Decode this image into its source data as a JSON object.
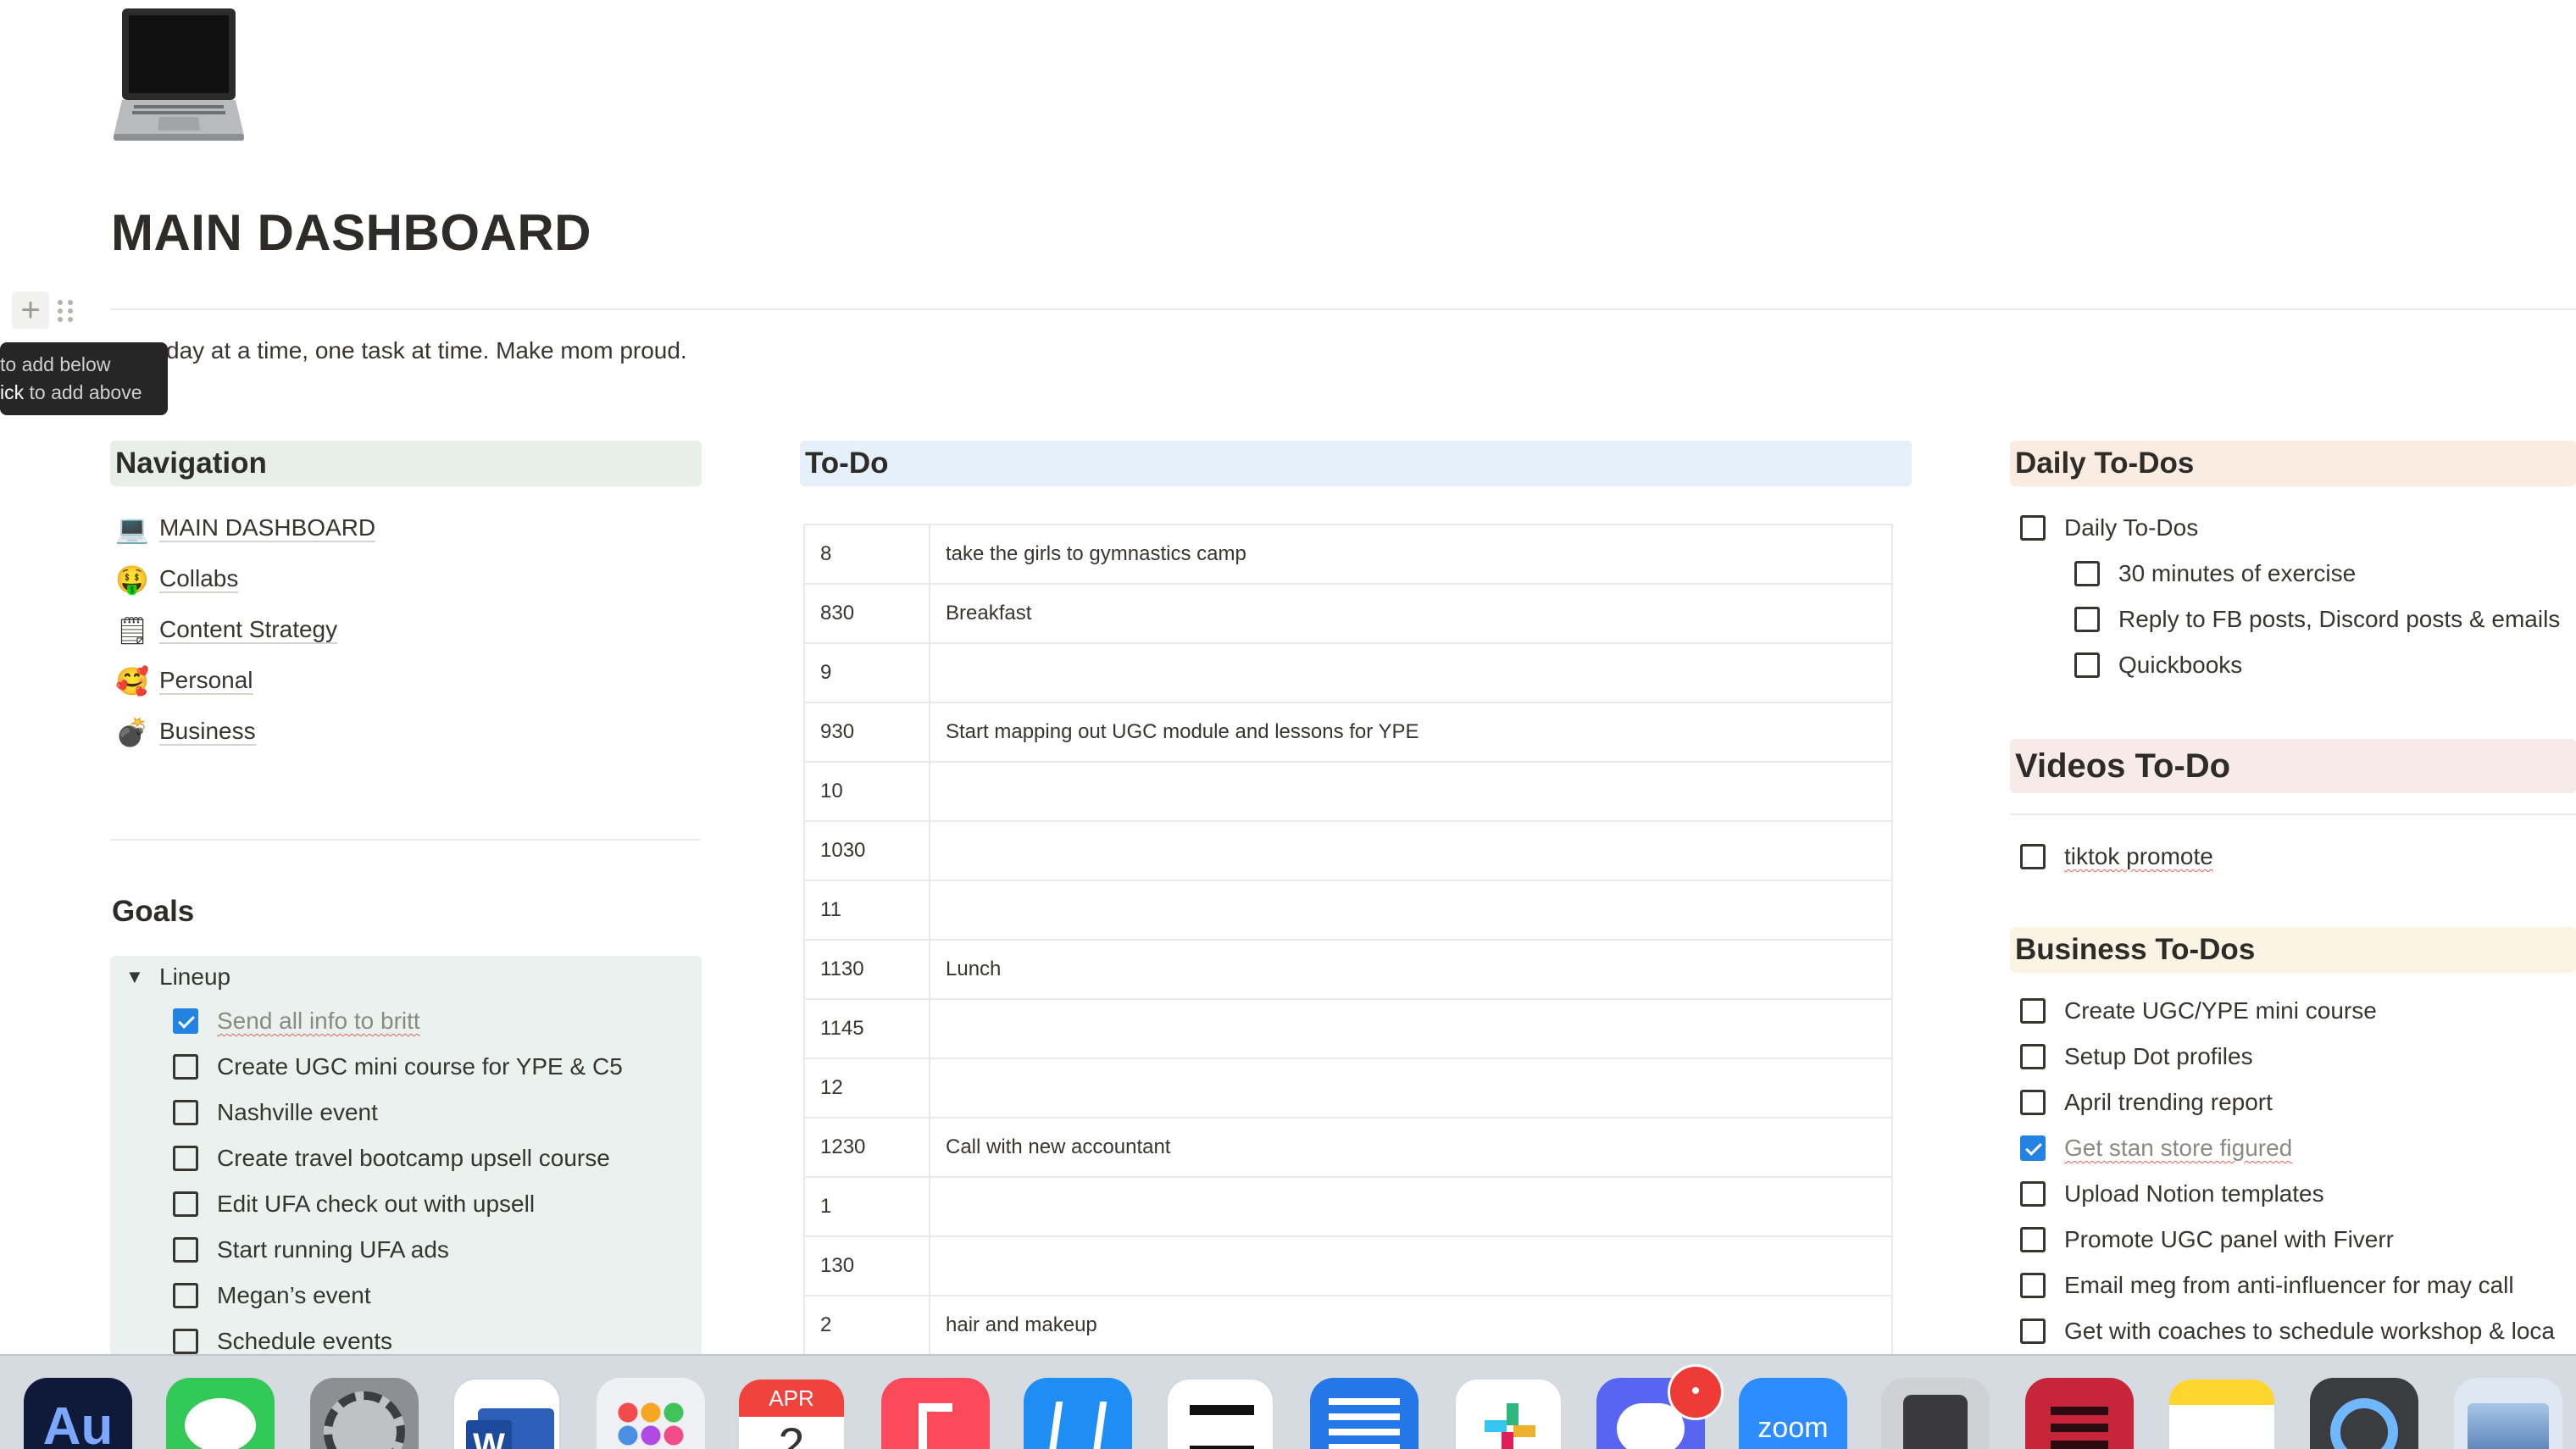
{
  "page": {
    "icon": "laptop-icon",
    "title": "MAIN DASHBOARD",
    "subtitle": "day at a time, one task at time. Make mom proud."
  },
  "block_tooltip": {
    "line1": "to add below",
    "line2_key": "ick",
    "line2_rest": " to add above"
  },
  "navigation": {
    "heading": "Navigation",
    "items": [
      {
        "emoji": "💻",
        "label": "MAIN DASHBOARD"
      },
      {
        "emoji": "🤑",
        "label": "Collabs"
      },
      {
        "emoji": "🗒",
        "label": "Content Strategy"
      },
      {
        "emoji": "🥰",
        "label": "Personal"
      },
      {
        "emoji": "💣",
        "label": "Business"
      }
    ]
  },
  "goals": {
    "heading": "Goals",
    "toggle_label": "Lineup",
    "items": [
      {
        "label": "Send all info to britt",
        "checked": true
      },
      {
        "label": "Create UGC mini course for YPE & C5",
        "checked": false
      },
      {
        "label": "Nashville event",
        "checked": false
      },
      {
        "label": "Create travel bootcamp upsell course",
        "checked": false
      },
      {
        "label": "Edit UFA check out with upsell",
        "checked": false
      },
      {
        "label": "Start running UFA ads",
        "checked": false
      },
      {
        "label": "Megan’s event",
        "checked": false
      },
      {
        "label": "Schedule events",
        "checked": false
      }
    ]
  },
  "todo": {
    "heading": "To-Do",
    "rows": [
      {
        "time": "8",
        "task": "take the girls to gymnastics camp"
      },
      {
        "time": "830",
        "task": "Breakfast"
      },
      {
        "time": "9",
        "task": ""
      },
      {
        "time": "930",
        "task": "Start mapping out UGC module and lessons for YPE"
      },
      {
        "time": "10",
        "task": ""
      },
      {
        "time": "1030",
        "task": ""
      },
      {
        "time": "11",
        "task": ""
      },
      {
        "time": "1130",
        "task": "Lunch"
      },
      {
        "time": "1145",
        "task": ""
      },
      {
        "time": "12",
        "task": ""
      },
      {
        "time": "1230",
        "task": "Call with new accountant"
      },
      {
        "time": "1",
        "task": ""
      },
      {
        "time": "130",
        "task": ""
      },
      {
        "time": "2",
        "task": "hair and makeup"
      }
    ]
  },
  "daily_todos": {
    "heading": "Daily To-Dos",
    "parent": {
      "label": "Daily To-Dos",
      "checked": false
    },
    "children": [
      {
        "label": "30 minutes of exercise",
        "checked": false
      },
      {
        "label": "Reply to FB posts, Discord posts & emails",
        "checked": false
      },
      {
        "label": "Quickbooks",
        "checked": false
      }
    ]
  },
  "videos_todo": {
    "heading": "Videos To-Do",
    "items": [
      {
        "label": "tiktok promote",
        "checked": false
      }
    ]
  },
  "business_todos": {
    "heading": "Business To-Dos",
    "items": [
      {
        "label": "Create UGC/YPE mini course",
        "checked": false
      },
      {
        "label": "Setup Dot profiles",
        "checked": false
      },
      {
        "label": "April trending report",
        "checked": false
      },
      {
        "label": "Get stan store figured ",
        "checked": true
      },
      {
        "label": "Upload Notion templates",
        "checked": false
      },
      {
        "label": "Promote UGC panel with Fiverr",
        "checked": false
      },
      {
        "label": "Email meg from anti-influencer for may call",
        "checked": false
      },
      {
        "label": "Get with coaches to schedule workshop & loca",
        "checked": false
      }
    ]
  },
  "dock": {
    "calendar_month": "APR",
    "calendar_day": "2",
    "word_letter": "W",
    "audition_letters": "Au",
    "zoom_label": "zoom",
    "discord_badge": "•",
    "apps": [
      "audition-icon",
      "messages-icon",
      "system-settings-icon",
      "word-icon",
      "launchpad-icon",
      "calendar-icon",
      "music-icon",
      "app-store-icon",
      "capcut-icon",
      "teleprompter-icon",
      "slack-icon",
      "discord-icon",
      "zoom-icon",
      "calculator-icon",
      "app-icon",
      "notes-icon",
      "quicktime-icon",
      "preview-icon"
    ]
  },
  "colors": {
    "nav_header_bg": "#e8efeb",
    "todo_header_bg": "#e5f0fa",
    "daily_header_bg": "#fbece1",
    "videos_header_bg": "#f7ebe8",
    "business_header_bg": "#fbf3e3",
    "checkbox_checked": "#2383e2"
  }
}
